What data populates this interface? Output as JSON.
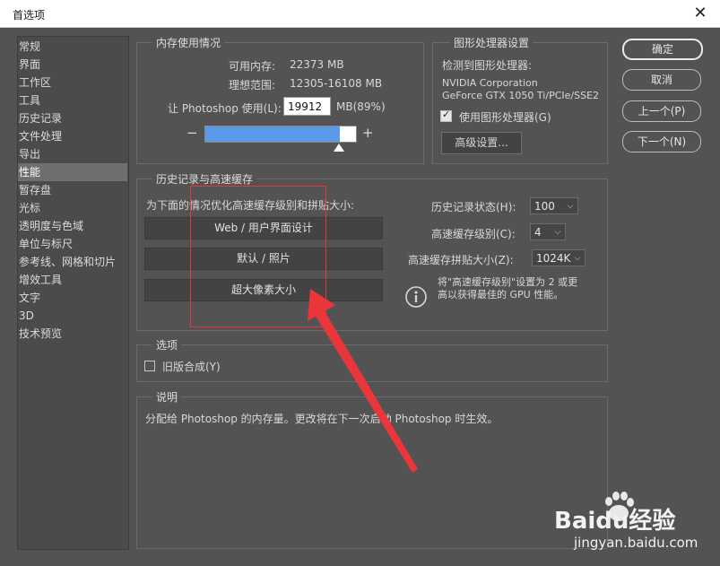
{
  "window": {
    "title": "首选项",
    "close_glyph": "✕"
  },
  "sidebar": {
    "items": [
      {
        "label": "常规"
      },
      {
        "label": "界面"
      },
      {
        "label": "工作区"
      },
      {
        "label": "工具"
      },
      {
        "label": "历史记录"
      },
      {
        "label": "文件处理"
      },
      {
        "label": "导出"
      },
      {
        "label": "性能"
      },
      {
        "label": "暂存盘"
      },
      {
        "label": "光标"
      },
      {
        "label": "透明度与色域"
      },
      {
        "label": "单位与标尺"
      },
      {
        "label": "参考线、网格和切片"
      },
      {
        "label": "增效工具"
      },
      {
        "label": "文字"
      },
      {
        "label": "3D"
      },
      {
        "label": "技术预览"
      }
    ],
    "active_index": 7
  },
  "memory": {
    "title": "内存使用情况",
    "available_label": "可用内存:",
    "available_value": "22373 MB",
    "ideal_label": "理想范围:",
    "ideal_value": "12305-16108 MB",
    "let_label": "让 Photoshop 使用(L):",
    "let_value": "19912",
    "let_unit": "MB(89%)",
    "slider_fraction": 0.89,
    "minus": "−",
    "plus": "+"
  },
  "gpu": {
    "title": "图形处理器设置",
    "detected_label": "检测到图形处理器:",
    "vendor": "NVIDIA Corporation",
    "model": "GeForce GTX 1050 Ti/PCIe/SSE2",
    "use_gpu_label": "使用图形处理器(G)",
    "use_gpu_checked": true,
    "advanced_button": "高级设置..."
  },
  "buttons": {
    "ok": "确定",
    "cancel": "取消",
    "prev": "上一个(P)",
    "next": "下一个(N)"
  },
  "history_cache": {
    "title": "历史记录与高速缓存",
    "optimize_label": "为下面的情况优化高速缓存级别和拼贴大小:",
    "preset_web": "Web / 用户界面设计",
    "preset_default": "默认 / 照片",
    "preset_huge": "超大像素大小",
    "history_states_label": "历史记录状态(H):",
    "history_states_value": "100",
    "cache_levels_label": "高速缓存级别(C):",
    "cache_levels_value": "4",
    "tile_size_label": "高速缓存拼贴大小(Z):",
    "tile_size_value": "1024K",
    "info_line1": "将\"高速缓存级别\"设置为 2 或更",
    "info_line2": "高以获得最佳的 GPU 性能。"
  },
  "options": {
    "title": "选项",
    "legacy_label": "旧版合成(Y)",
    "legacy_checked": false
  },
  "description": {
    "title": "说明",
    "text": "分配给 Photoshop 的内存量。更改将在下一次启动 Photoshop 时生效。"
  },
  "colors": {
    "dialog_bg": "#535353",
    "slider_fill": "#5b9ae8",
    "annotation_red": "#e8363a"
  },
  "watermark": {
    "brand": "Baidu经验",
    "url": "jingyan.baidu.com"
  }
}
